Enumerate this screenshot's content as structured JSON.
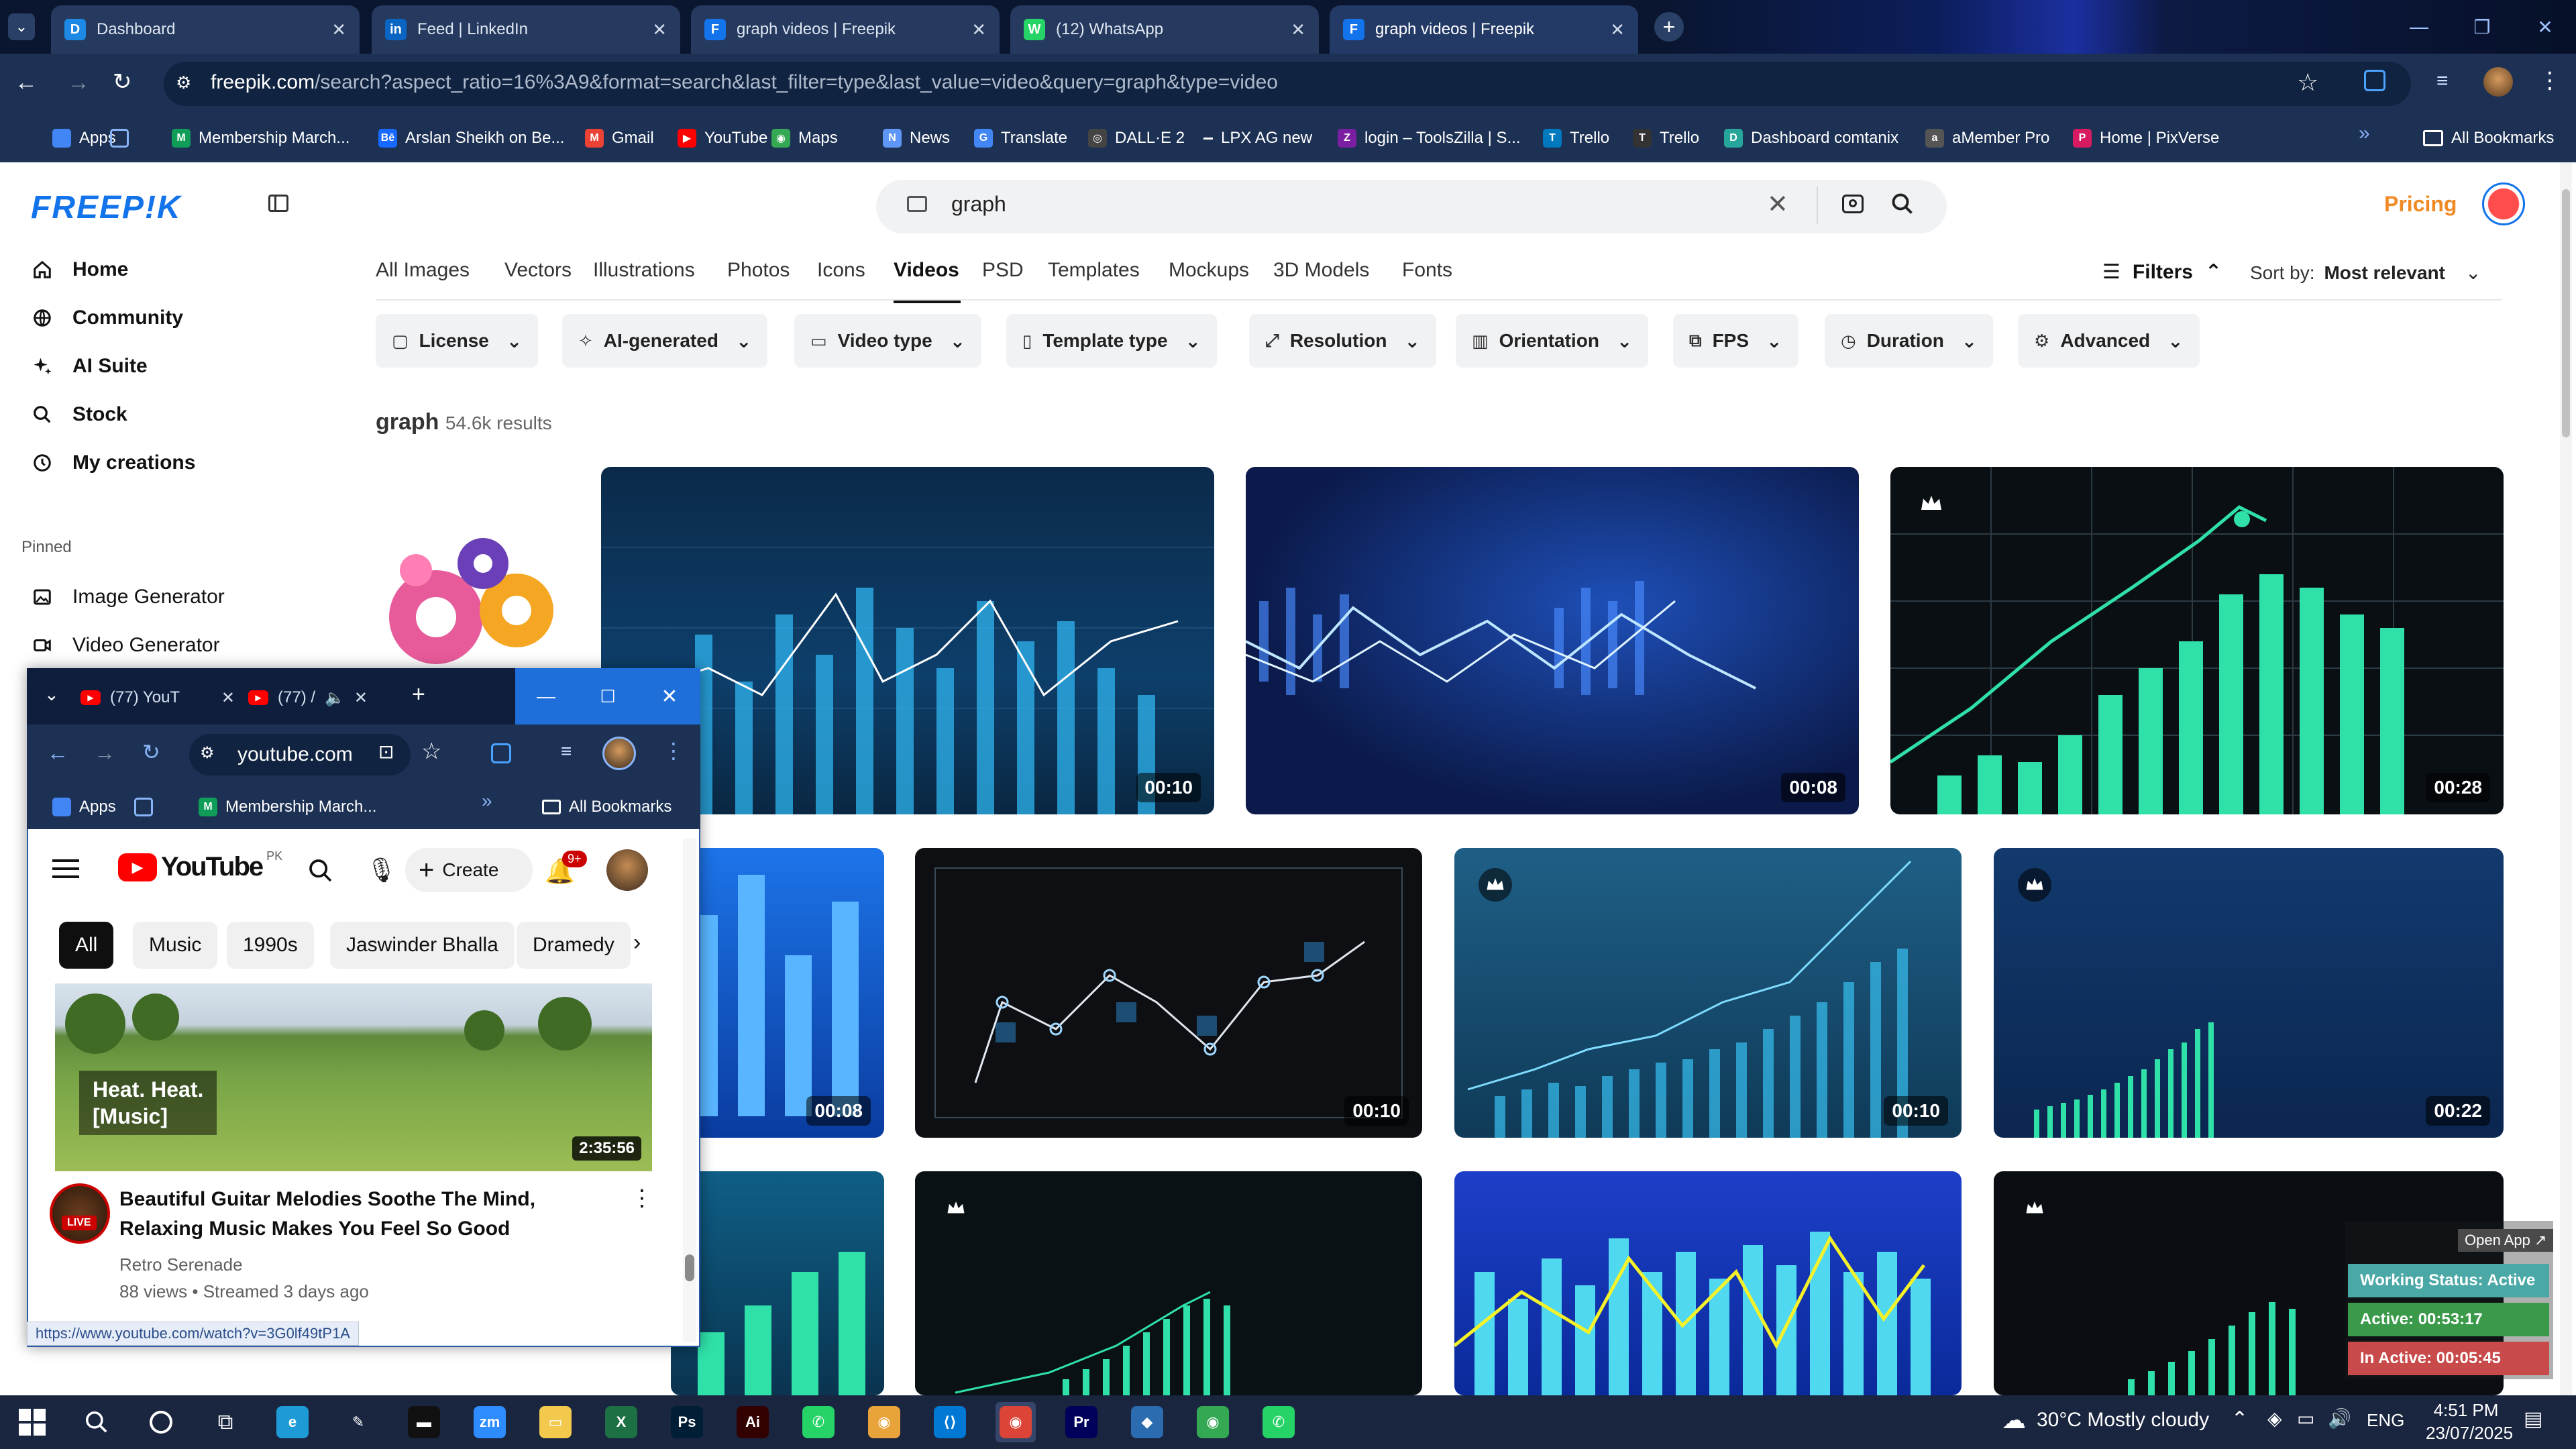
{
  "browser": {
    "tabs": [
      {
        "label": "Dashboard",
        "icon": "D",
        "color": "#1e88e5"
      },
      {
        "label": "Feed | LinkedIn",
        "icon": "in",
        "color": "#0a66c2"
      },
      {
        "label": "graph videos | Freepik",
        "icon": "F",
        "color": "#1273eb"
      },
      {
        "label": "(12) WhatsApp",
        "icon": "W",
        "color": "#25d366"
      },
      {
        "label": "graph videos | Freepik",
        "icon": "F",
        "color": "#1273eb"
      }
    ],
    "url_host": "freepik.com",
    "url_path": "/search?aspect_ratio=16%3A9&format=search&last_filter=type&last_value=video&query=graph&type=video",
    "bookmarks": [
      {
        "label": "Apps",
        "icon": "",
        "color": "#4285f4"
      },
      {
        "label": "",
        "icon": "",
        "color": "#1c3154"
      },
      {
        "label": "Membership March...",
        "icon": "M",
        "color": "#0f9d58"
      },
      {
        "label": "Arslan Sheikh on Be...",
        "icon": "Bē",
        "color": "#1769ff"
      },
      {
        "label": "Gmail",
        "icon": "M",
        "color": "#ea4335"
      },
      {
        "label": "YouTube",
        "icon": "▶",
        "color": "#ff0000"
      },
      {
        "label": "Maps",
        "icon": "◉",
        "color": "#34a853"
      },
      {
        "label": "News",
        "icon": "N",
        "color": "#5e97f6"
      },
      {
        "label": "Translate",
        "icon": "G",
        "color": "#4285f4"
      },
      {
        "label": "DALL·E 2",
        "icon": "◎",
        "color": "#444"
      },
      {
        "label": "LPX AG new",
        "icon": "",
        "color": "#1c3154"
      },
      {
        "label": "login – ToolsZilla | S...",
        "icon": "Z",
        "color": "#7b1fa2"
      },
      {
        "label": "Trello",
        "icon": "T",
        "color": "#0079bf"
      },
      {
        "label": "Trello",
        "icon": "T",
        "color": "#333"
      },
      {
        "label": "Dashboard comtanix",
        "icon": "D",
        "color": "#26a69a"
      },
      {
        "label": "aMember Pro",
        "icon": "a",
        "color": "#555"
      },
      {
        "label": "Home | PixVerse",
        "icon": "P",
        "color": "#d81b60"
      }
    ],
    "all_bookmarks": "All Bookmarks"
  },
  "freepik": {
    "logo": "FREEP!K",
    "sidebar": [
      {
        "label": "Home",
        "icon": "home-icon"
      },
      {
        "label": "Community",
        "icon": "globe-icon"
      },
      {
        "label": "AI Suite",
        "icon": "sparkle-icon"
      },
      {
        "label": "Stock",
        "icon": "search-icon"
      },
      {
        "label": "My creations",
        "icon": "history-icon"
      }
    ],
    "pinned_label": "Pinned",
    "pinned": [
      {
        "label": "Image Generator",
        "icon": "image-icon"
      },
      {
        "label": "Video Generator",
        "icon": "video-icon"
      }
    ],
    "search_value": "graph",
    "pricing": "Pricing",
    "categories": [
      "All Images",
      "Vectors",
      "Illustrations",
      "Photos",
      "Icons",
      "Videos",
      "PSD",
      "Templates",
      "Mockups",
      "3D Models",
      "Fonts"
    ],
    "active_category": "Videos",
    "filters_label": "Filters",
    "sort_label": "Sort by:",
    "sort_value": "Most relevant",
    "filter_buttons": [
      "License",
      "AI-generated",
      "Video type",
      "Template type",
      "Resolution",
      "Orientation",
      "FPS",
      "Duration",
      "Advanced"
    ],
    "query": "graph",
    "results": "54.6k results",
    "durations": [
      "00:10",
      "00:08",
      "00:28",
      "00:08",
      "00:10",
      "00:10",
      "00:22"
    ]
  },
  "youtube": {
    "tabs": [
      "(77) YouT",
      "(77) /"
    ],
    "url": "youtube.com",
    "bookmarks": [
      "Apps",
      "Membership March..."
    ],
    "all_bookmarks": "All Bookmarks",
    "logo": "YouTube",
    "country": "PK",
    "create": "Create",
    "notif": "9+",
    "chips": [
      "All",
      "Music",
      "1990s",
      "Jaswinder Bhalla",
      "Dramedy"
    ],
    "video_overlay": "Heat. Heat.\n[Music]",
    "video_duration": "2:35:56",
    "video_title": "Beautiful Guitar Melodies Soothe The Mind, Relaxing Music Makes You Feel So Good",
    "channel": "Retro Serenade",
    "meta": "88 views • Streamed 3 days ago",
    "live": "LIVE",
    "status_url": "https://www.youtube.com/watch?v=3G0lf49tP1A"
  },
  "widget": {
    "open_app": "Open App ↗",
    "working": "Working Status: Active",
    "active": "Active: 00:53:17",
    "inactive": "In Active: 00:05:45"
  },
  "taskbar": {
    "weather": "30°C  Mostly cloudy",
    "lang": "ENG",
    "time": "4:51 PM",
    "date": "23/07/2025"
  },
  "colors": {
    "accent": "#1273eb",
    "pricing": "#f08a24",
    "browser_bg": "#1c3154"
  }
}
